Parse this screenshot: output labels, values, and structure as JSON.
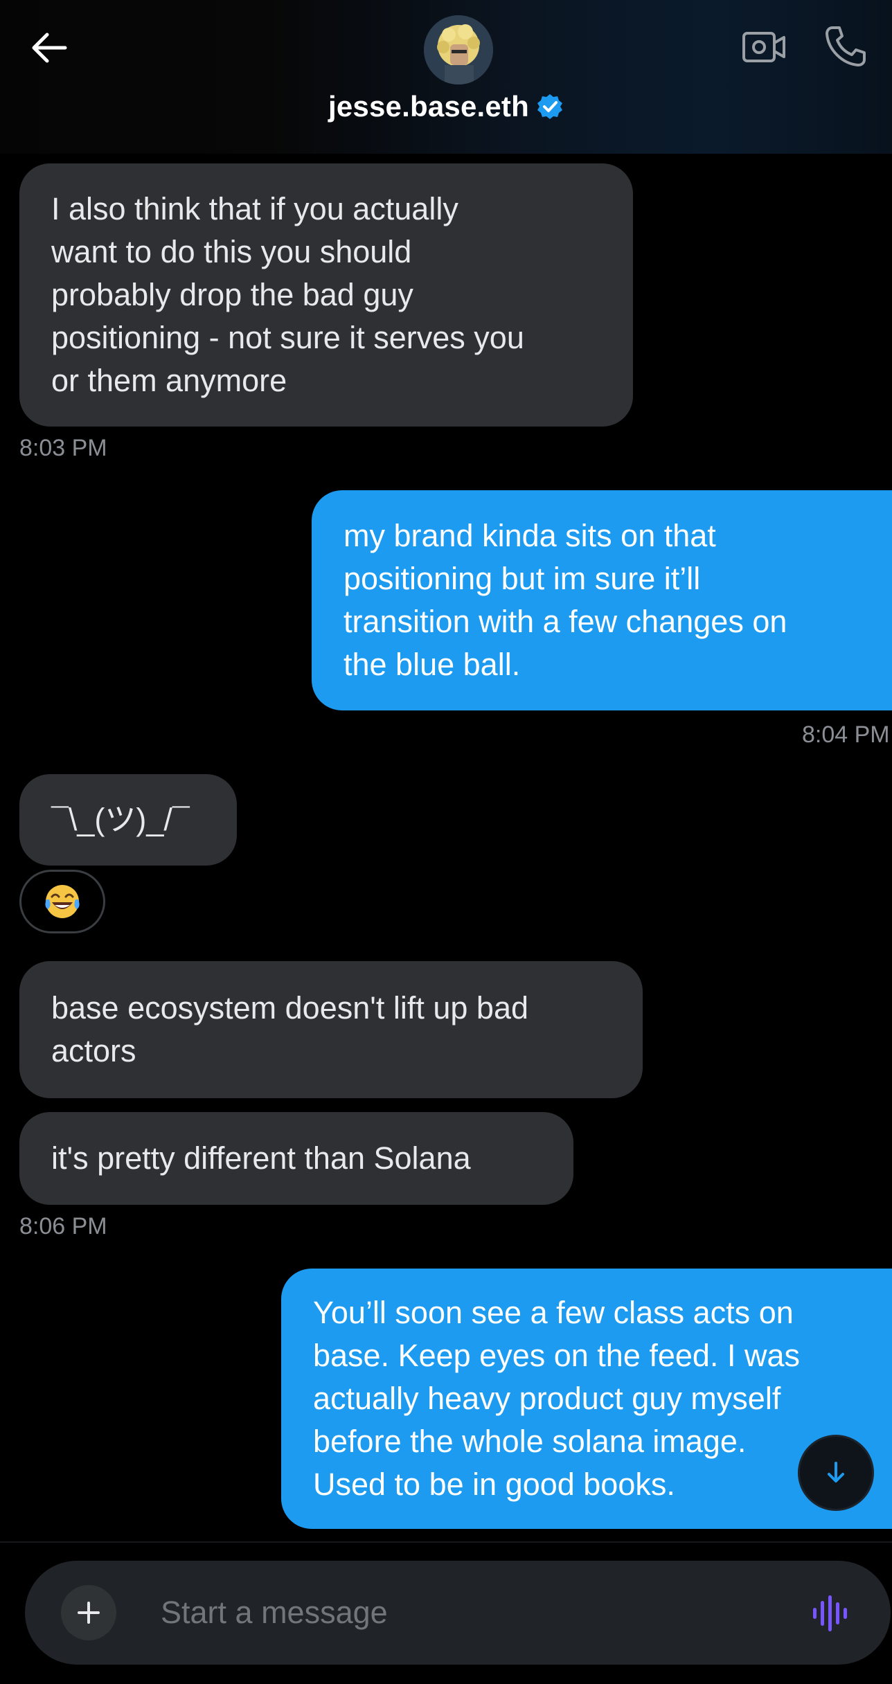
{
  "header": {
    "name": "jesse.base.eth",
    "verified_color": "#1d9bf0"
  },
  "messages": [
    {
      "id": "m1",
      "side": "received",
      "text": "I also think that if you actually want to do this you should probably drop the bad guy positioning - not sure it serves you or them anymore",
      "lines": [
        "I also think that if you actually",
        "want to do this you should",
        "probably drop the bad guy",
        "positioning - not sure it serves you",
        "or them anymore"
      ]
    },
    {
      "id": "m2",
      "side": "sent",
      "lines": [
        "my brand kinda sits on that",
        "positioning but im sure it’ll",
        "transition with a few changes on",
        "the blue ball."
      ]
    },
    {
      "id": "m3",
      "side": "received",
      "lines": [
        "¯\\_(ツ)_/¯"
      ]
    },
    {
      "id": "m4",
      "side": "received",
      "lines": [
        "base ecosystem doesn't lift up bad",
        "actors"
      ]
    },
    {
      "id": "m5",
      "side": "received",
      "lines": [
        "it's pretty different than Solana"
      ]
    },
    {
      "id": "m6",
      "side": "sent",
      "lines": [
        "You’ll soon see a few class acts on",
        "base. Keep eyes on the feed. I was",
        "actually heavy product guy myself",
        "before the whole solana image.",
        "Used to be in good books."
      ]
    }
  ],
  "timestamps": {
    "t1": "8:03 PM",
    "t2": "8:04 PM",
    "t3": "8:06 PM"
  },
  "reaction": {
    "emoji": "😂",
    "icon": "tears-of-joy-emoji"
  },
  "composer": {
    "placeholder": "Start a message",
    "plus_label": "+"
  },
  "colors": {
    "sent_bubble": "#1d9bf0",
    "received_bubble": "#2f3033",
    "voice_icon": "#7856ff"
  },
  "icons": [
    "back-arrow-icon",
    "avatar",
    "verified-badge-icon",
    "video-call-icon",
    "phone-icon",
    "scroll-down-arrow-icon",
    "plus-icon",
    "voice-message-icon"
  ]
}
